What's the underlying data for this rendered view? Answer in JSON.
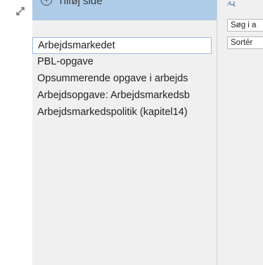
{
  "pages_pane": {
    "add_page_label": "Tilføj side",
    "pages": [
      {
        "label": "Arbejdsmarkedet",
        "selected": true
      },
      {
        "label": "PBL-opgave",
        "selected": false
      },
      {
        "label": "Opsummerende opgave i arbejds",
        "selected": false
      },
      {
        "label": "Arbejdsopgave: Arbejdsmarkedsb",
        "selected": false
      },
      {
        "label": "Arbejdsmarkedspolitik (kapitel14)",
        "selected": false
      }
    ]
  },
  "right_pane": {
    "search_placeholder": "Søg i a",
    "sort_label": "Sortér"
  },
  "colors": {
    "add_bar_bg": "#aecbe8",
    "pane_bg": "#f0f0f0",
    "selected_border": "#9bbbe0"
  }
}
